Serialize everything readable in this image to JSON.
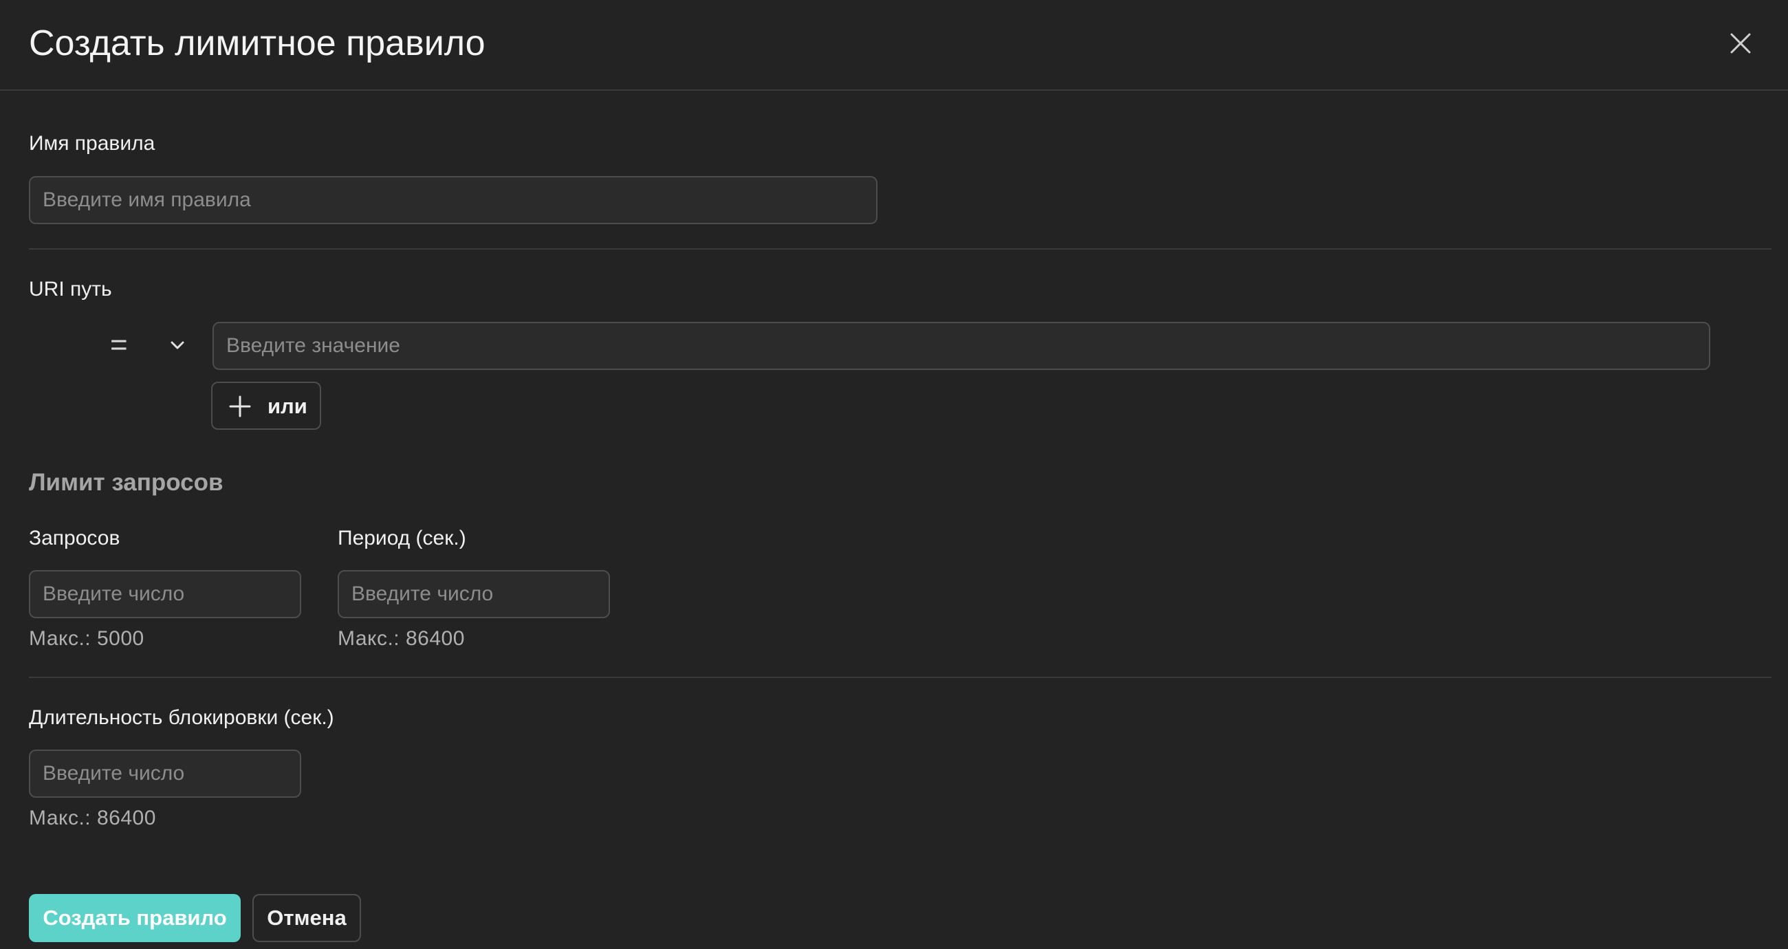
{
  "dialog": {
    "title": "Создать лимитное правило",
    "close_icon": "close-icon"
  },
  "rule_name": {
    "label": "Имя правила",
    "placeholder": "Введите имя правила",
    "value": ""
  },
  "uri_path": {
    "label": "URI путь",
    "operator": "=",
    "operator_icon": "chevron-down-icon",
    "value_placeholder": "Введите значение",
    "value": "",
    "or_button_label": "или",
    "or_button_icon": "plus-icon"
  },
  "rate_limit": {
    "section_title": "Лимит запросов",
    "requests": {
      "label": "Запросов",
      "placeholder": "Введите число",
      "value": "",
      "hint": "Макс.: 5000"
    },
    "period": {
      "label": "Период (сек.)",
      "placeholder": "Введите число",
      "value": "",
      "hint": "Макс.: 86400"
    }
  },
  "block_duration": {
    "label": "Длительность блокировки (сек.)",
    "placeholder": "Введите число",
    "value": "",
    "hint": "Макс.: 86400"
  },
  "actions": {
    "submit_label": "Создать правило",
    "cancel_label": "Отмена"
  },
  "colors": {
    "background": "#232323",
    "accent": "#5cd2c8",
    "border": "#4d4d4d",
    "divider": "#3a3a3a"
  }
}
